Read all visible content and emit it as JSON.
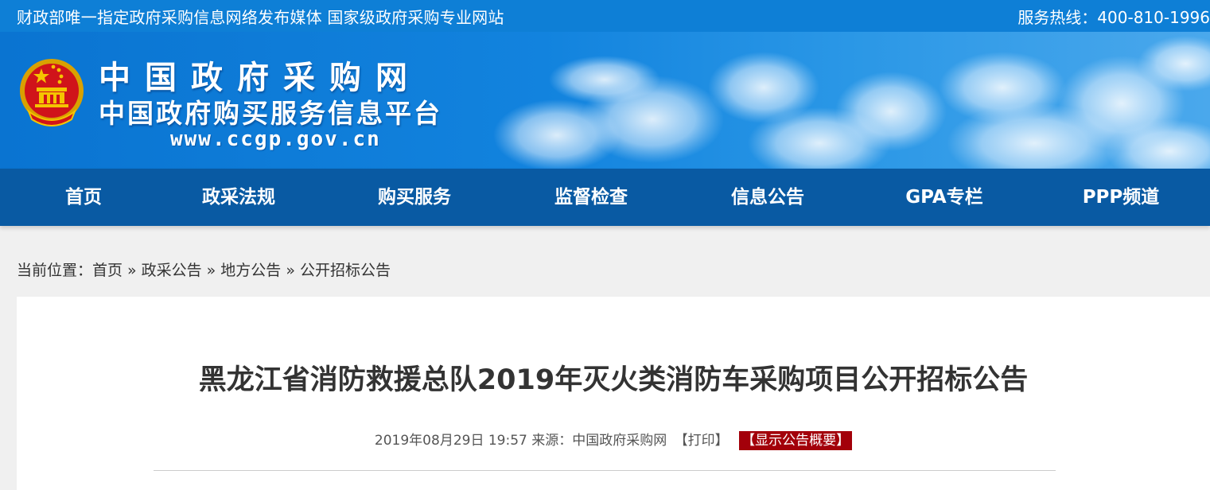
{
  "topbar": {
    "slogan": "财政部唯一指定政府采购信息网络发布媒体 国家级政府采购专业网站",
    "hotline": "服务热线：400-810-1996"
  },
  "header": {
    "site_name": "中国政府采购网",
    "subtitle": "中国政府购买服务信息平台",
    "url": "www.ccgp.gov.cn",
    "emblem_icon": "national-emblem-icon"
  },
  "nav": {
    "items": [
      {
        "label": "首页"
      },
      {
        "label": "政采法规"
      },
      {
        "label": "购买服务"
      },
      {
        "label": "监督检查"
      },
      {
        "label": "信息公告"
      },
      {
        "label": "GPA专栏"
      },
      {
        "label": "PPP频道"
      }
    ]
  },
  "breadcrumb": {
    "prefix": "当前位置：",
    "items": [
      "首页",
      "政采公告",
      "地方公告",
      "公开招标公告"
    ],
    "separator": "»"
  },
  "article": {
    "title": "黑龙江省消防救援总队2019年灭火类消防车采购项目公开招标公告",
    "datetime": "2019年08月29日 19:57",
    "source": "来源：中国政府采购网",
    "print_label": "【打印】",
    "summary_label": "【显示公告概要】"
  },
  "colors": {
    "topbar": "#0e7fd6",
    "nav": "#095aa3",
    "summary_button": "#a3000a",
    "page_background": "#f0f0f0"
  }
}
